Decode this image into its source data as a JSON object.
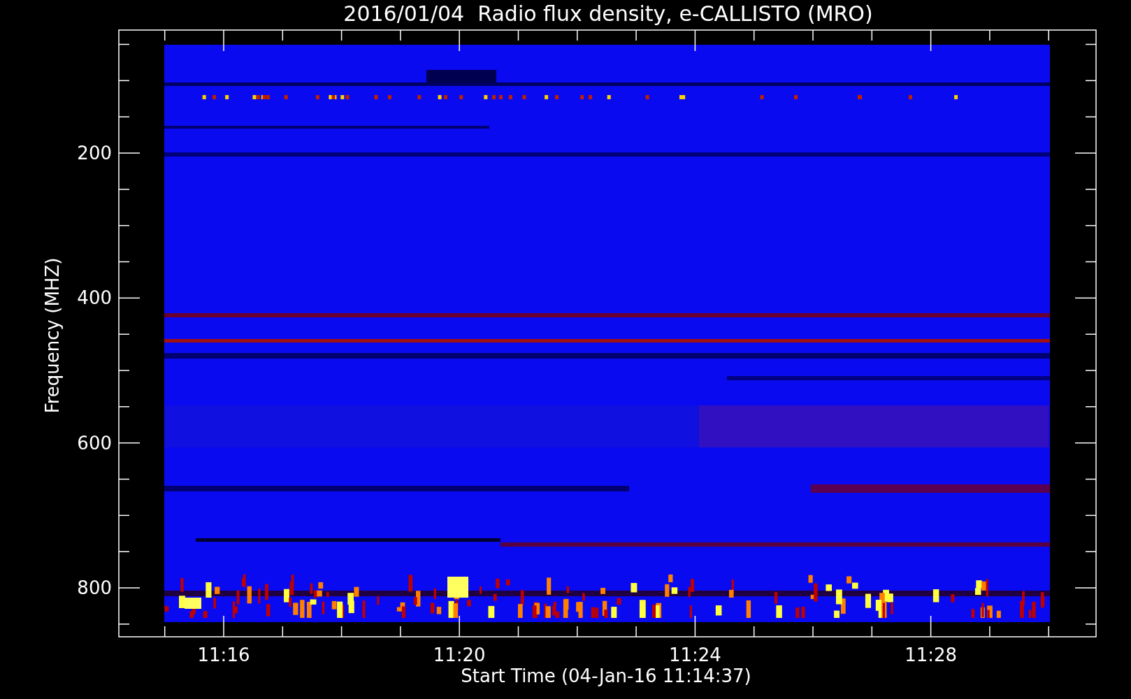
{
  "title": "2016/01/04  Radio flux density, e-CALLISTO (MRO)",
  "y_axis": {
    "label": "Frequency (MHZ)",
    "ticks": [
      "200",
      "400",
      "600",
      "800"
    ]
  },
  "x_axis": {
    "label": "Start Time (04-Jan-16 11:14:37)",
    "ticks": [
      "11:16",
      "11:20",
      "11:24",
      "11:28"
    ]
  }
}
